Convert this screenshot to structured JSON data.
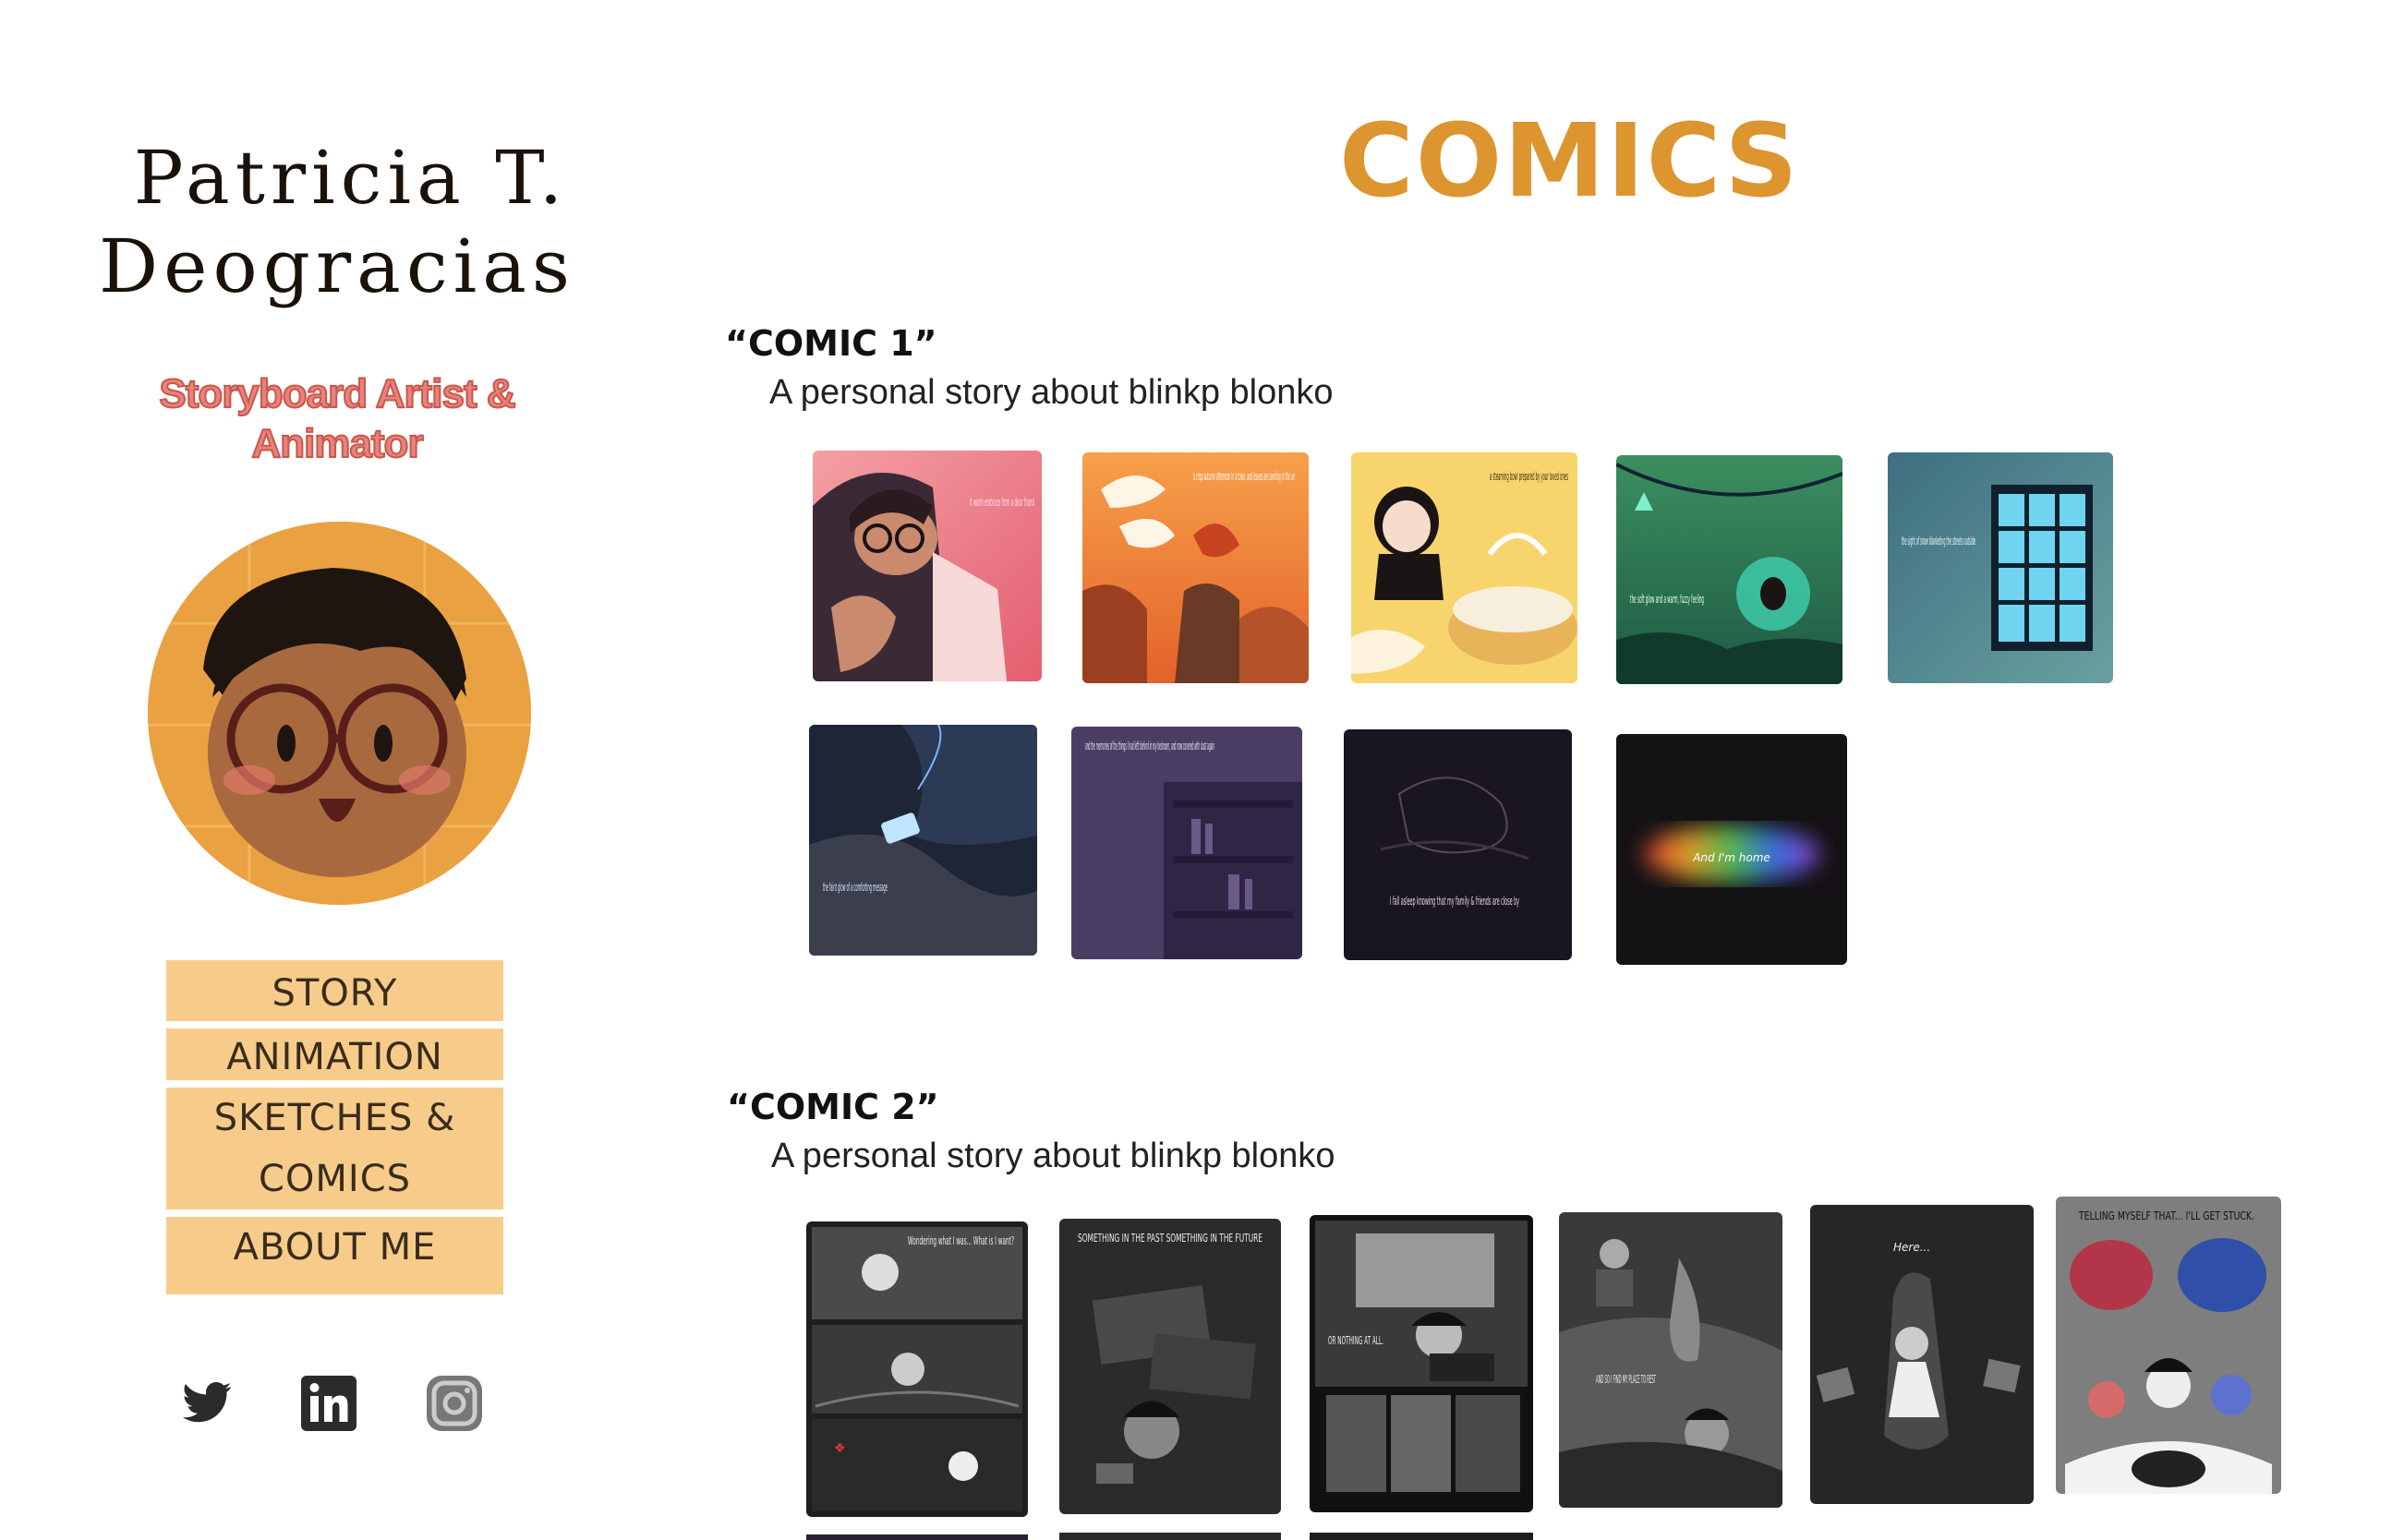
{
  "sidebar": {
    "logo_line1": "Patricia T.",
    "logo_line2": "Deogracias",
    "tagline": "Storyboard Artist & Animator",
    "nav": [
      {
        "label": "STORY"
      },
      {
        "label": "ANIMATION"
      },
      {
        "label": "SKETCHES & COMICS"
      },
      {
        "label": "ABOUT ME"
      }
    ],
    "social": [
      {
        "icon": "twitter-icon"
      },
      {
        "icon": "linkedin-icon"
      },
      {
        "icon": "instagram-icon"
      }
    ]
  },
  "main": {
    "title": "COMICS",
    "comics": [
      {
        "title": "“COMIC 1”",
        "description": "A personal story about blinkp  blonko",
        "panels": [
          {
            "text": "it warm embrace from a dear friend"
          },
          {
            "text": "a crisp autumn afternoon in a town, and leaves are swirling in the air"
          },
          {
            "text": "a steaming bowl prepared by your loved ones"
          },
          {
            "text": "the soft glow and a warm, fuzzy feeling"
          },
          {
            "text": "the sight of snow blanketing the streets outside"
          },
          {
            "text": "the faint glow of a comforting message"
          },
          {
            "text": "and the memories of the things I had left behind in my bedroom, and now covered with dust again"
          },
          {
            "text": "I fall asleep knowing that my family & friends are close by"
          },
          {
            "text": "And I'm home"
          }
        ]
      },
      {
        "title": "“COMIC 2”",
        "description": "A personal story about blinkp  blonko",
        "panels": [
          {
            "text": "Wondering what I was... What is I want?"
          },
          {
            "text": "SOMETHING IN THE PAST SOMETHING IN THE FUTURE"
          },
          {
            "text": "OR NOTHING AT ALL."
          },
          {
            "text": "AND SO I FIND MY PLACE TO REST"
          },
          {
            "text": "Here..."
          },
          {
            "text": "TELLING MYSELF THAT... I'LL GET STUCK."
          }
        ]
      }
    ]
  }
}
